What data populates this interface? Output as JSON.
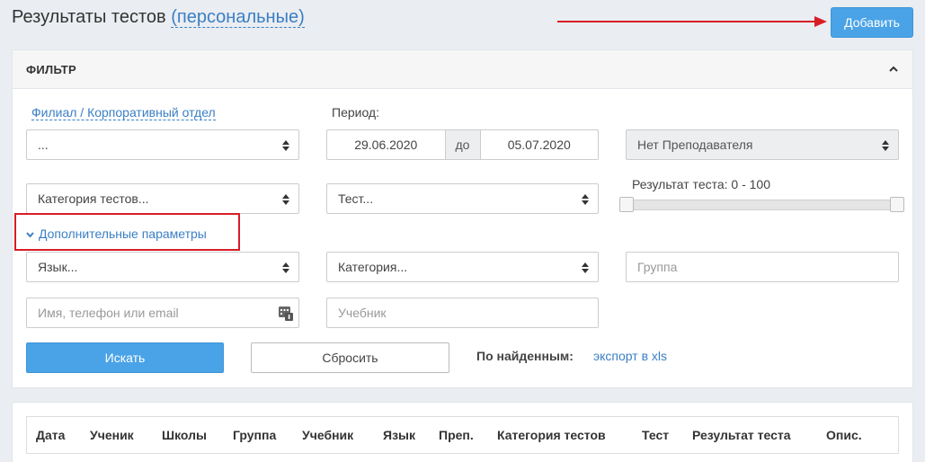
{
  "header": {
    "title": "Результаты тестов",
    "title_link": "(персональные)",
    "add_button": "Добавить"
  },
  "filter": {
    "title": "ФИЛЬТР",
    "branch_label": "Филиал / Корпоративный отдел",
    "branch_value": "...",
    "period_label": "Период:",
    "date_from": "29.06.2020",
    "date_sep": "до",
    "date_to": "05.07.2020",
    "teacher_value": "Нет Преподавателя",
    "test_category_value": "Категория тестов...",
    "test_value": "Тест...",
    "result_label": "Результат теста: 0 - 100",
    "more_params": "Дополнительные параметры",
    "language_value": "Язык...",
    "category_value": "Категория...",
    "group_placeholder": "Группа",
    "contact_placeholder": "Имя, телефон или email",
    "textbook_placeholder": "Учебник",
    "search_button": "Искать",
    "reset_button": "Сбросить",
    "found_label": "По найденным:",
    "export_link": "экспорт в xls"
  },
  "table": {
    "columns": [
      "Дата",
      "Ученик",
      "Школы",
      "Группа",
      "Учебник",
      "Язык",
      "Преп.",
      "Категория тестов",
      "Тест",
      "Результат теста",
      "Опис."
    ]
  },
  "colors": {
    "accent": "#4aa3e6",
    "link": "#3b7fc4",
    "annotation": "#d81e25"
  }
}
